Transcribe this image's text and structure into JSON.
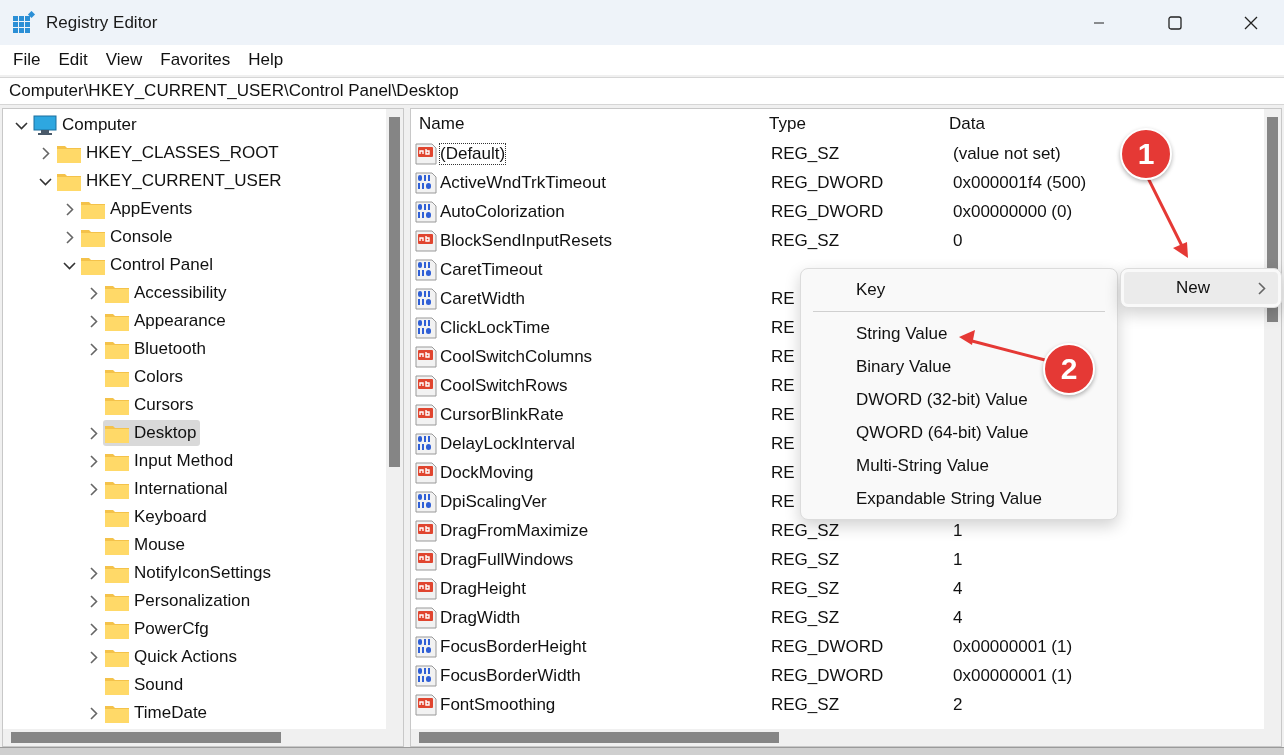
{
  "window": {
    "title": "Registry Editor"
  },
  "menu_bar": [
    "File",
    "Edit",
    "View",
    "Favorites",
    "Help"
  ],
  "address_bar": {
    "value": "Computer\\HKEY_CURRENT_USER\\Control Panel\\Desktop"
  },
  "tree": [
    {
      "label": "Computer",
      "expandable": true,
      "expanded": true,
      "selected": false,
      "children": [
        {
          "label": "HKEY_CLASSES_ROOT",
          "expandable": true,
          "expanded": false,
          "selected": false
        },
        {
          "label": "HKEY_CURRENT_USER",
          "expandable": true,
          "expanded": true,
          "selected": false,
          "children": [
            {
              "label": "AppEvents",
              "expandable": true,
              "expanded": false,
              "selected": false
            },
            {
              "label": "Console",
              "expandable": true,
              "expanded": false,
              "selected": false
            },
            {
              "label": "Control Panel",
              "expandable": true,
              "expanded": true,
              "selected": false,
              "children": [
                {
                  "label": "Accessibility",
                  "expandable": true,
                  "expanded": false,
                  "selected": false
                },
                {
                  "label": "Appearance",
                  "expandable": true,
                  "expanded": false,
                  "selected": false
                },
                {
                  "label": "Bluetooth",
                  "expandable": true,
                  "expanded": false,
                  "selected": false
                },
                {
                  "label": "Colors",
                  "expandable": false,
                  "selected": false
                },
                {
                  "label": "Cursors",
                  "expandable": false,
                  "selected": false
                },
                {
                  "label": "Desktop",
                  "expandable": true,
                  "expanded": false,
                  "selected": true
                },
                {
                  "label": "Input Method",
                  "expandable": true,
                  "expanded": false,
                  "selected": false
                },
                {
                  "label": "International",
                  "expandable": true,
                  "expanded": false,
                  "selected": false
                },
                {
                  "label": "Keyboard",
                  "expandable": false,
                  "selected": false
                },
                {
                  "label": "Mouse",
                  "expandable": false,
                  "selected": false
                },
                {
                  "label": "NotifyIconSettings",
                  "expandable": true,
                  "expanded": false,
                  "selected": false
                },
                {
                  "label": "Personalization",
                  "expandable": true,
                  "expanded": false,
                  "selected": false
                },
                {
                  "label": "PowerCfg",
                  "expandable": true,
                  "expanded": false,
                  "selected": false
                },
                {
                  "label": "Quick Actions",
                  "expandable": true,
                  "expanded": false,
                  "selected": false
                },
                {
                  "label": "Sound",
                  "expandable": false,
                  "selected": false
                },
                {
                  "label": "TimeDate",
                  "expandable": true,
                  "expanded": false,
                  "selected": false
                }
              ]
            }
          ]
        }
      ]
    }
  ],
  "table": {
    "columns": [
      "Name",
      "Type",
      "Data"
    ],
    "rows": [
      {
        "kind": "string",
        "name": "(Default)",
        "type": "REG_SZ",
        "data": "(value not set)",
        "focused": true
      },
      {
        "kind": "binary",
        "name": "ActiveWndTrkTimeout",
        "type": "REG_DWORD",
        "data": "0x000001f4 (500)",
        "focused": false
      },
      {
        "kind": "binary",
        "name": "AutoColorization",
        "type": "REG_DWORD",
        "data": "0x00000000 (0)",
        "focused": false
      },
      {
        "kind": "string",
        "name": "BlockSendInputResets",
        "type": "REG_SZ",
        "data": "0",
        "focused": false
      },
      {
        "kind": "binary",
        "name": "CaretTimeout",
        "focused": false
      },
      {
        "kind": "binary",
        "name": "CaretWidth",
        "type": "RE",
        "focused": false
      },
      {
        "kind": "binary",
        "name": "ClickLockTime",
        "type": "RE",
        "focused": false
      },
      {
        "kind": "string",
        "name": "CoolSwitchColumns",
        "type": "RE",
        "focused": false
      },
      {
        "kind": "string",
        "name": "CoolSwitchRows",
        "type": "RE",
        "focused": false
      },
      {
        "kind": "string",
        "name": "CursorBlinkRate",
        "type": "RE",
        "focused": false
      },
      {
        "kind": "binary",
        "name": "DelayLockInterval",
        "type": "RE",
        "focused": false
      },
      {
        "kind": "string",
        "name": "DockMoving",
        "type": "RE",
        "focused": false
      },
      {
        "kind": "binary",
        "name": "DpiScalingVer",
        "type": "RE",
        "focused": false
      },
      {
        "kind": "string",
        "name": "DragFromMaximize",
        "type": "REG_SZ",
        "data": "1",
        "focused": false
      },
      {
        "kind": "string",
        "name": "DragFullWindows",
        "type": "REG_SZ",
        "data": "1",
        "focused": false
      },
      {
        "kind": "string",
        "name": "DragHeight",
        "type": "REG_SZ",
        "data": "4",
        "focused": false
      },
      {
        "kind": "string",
        "name": "DragWidth",
        "type": "REG_SZ",
        "data": "4",
        "focused": false
      },
      {
        "kind": "binary",
        "name": "FocusBorderHeight",
        "type": "REG_DWORD",
        "data": "0x00000001 (1)",
        "focused": false
      },
      {
        "kind": "binary",
        "name": "FocusBorderWidth",
        "type": "REG_DWORD",
        "data": "0x00000001 (1)",
        "focused": false
      },
      {
        "kind": "string",
        "name": "FontSmoothing",
        "type": "REG_SZ",
        "data": "2",
        "focused": false
      }
    ]
  },
  "context_menu": {
    "items": [
      {
        "kind": "item",
        "label": "Key"
      },
      {
        "kind": "separator"
      },
      {
        "kind": "item",
        "label": "String Value"
      },
      {
        "kind": "item",
        "label": "Binary Value"
      },
      {
        "kind": "item",
        "label": "DWORD (32-bit) Value"
      },
      {
        "kind": "item",
        "label": "QWORD (64-bit) Value"
      },
      {
        "kind": "item",
        "label": "Multi-String Value"
      },
      {
        "kind": "item",
        "label": "Expandable String Value"
      }
    ],
    "parent_item": {
      "label": "New",
      "highlighted": true
    }
  },
  "annotations": [
    {
      "label": "1"
    },
    {
      "label": "2"
    }
  ]
}
